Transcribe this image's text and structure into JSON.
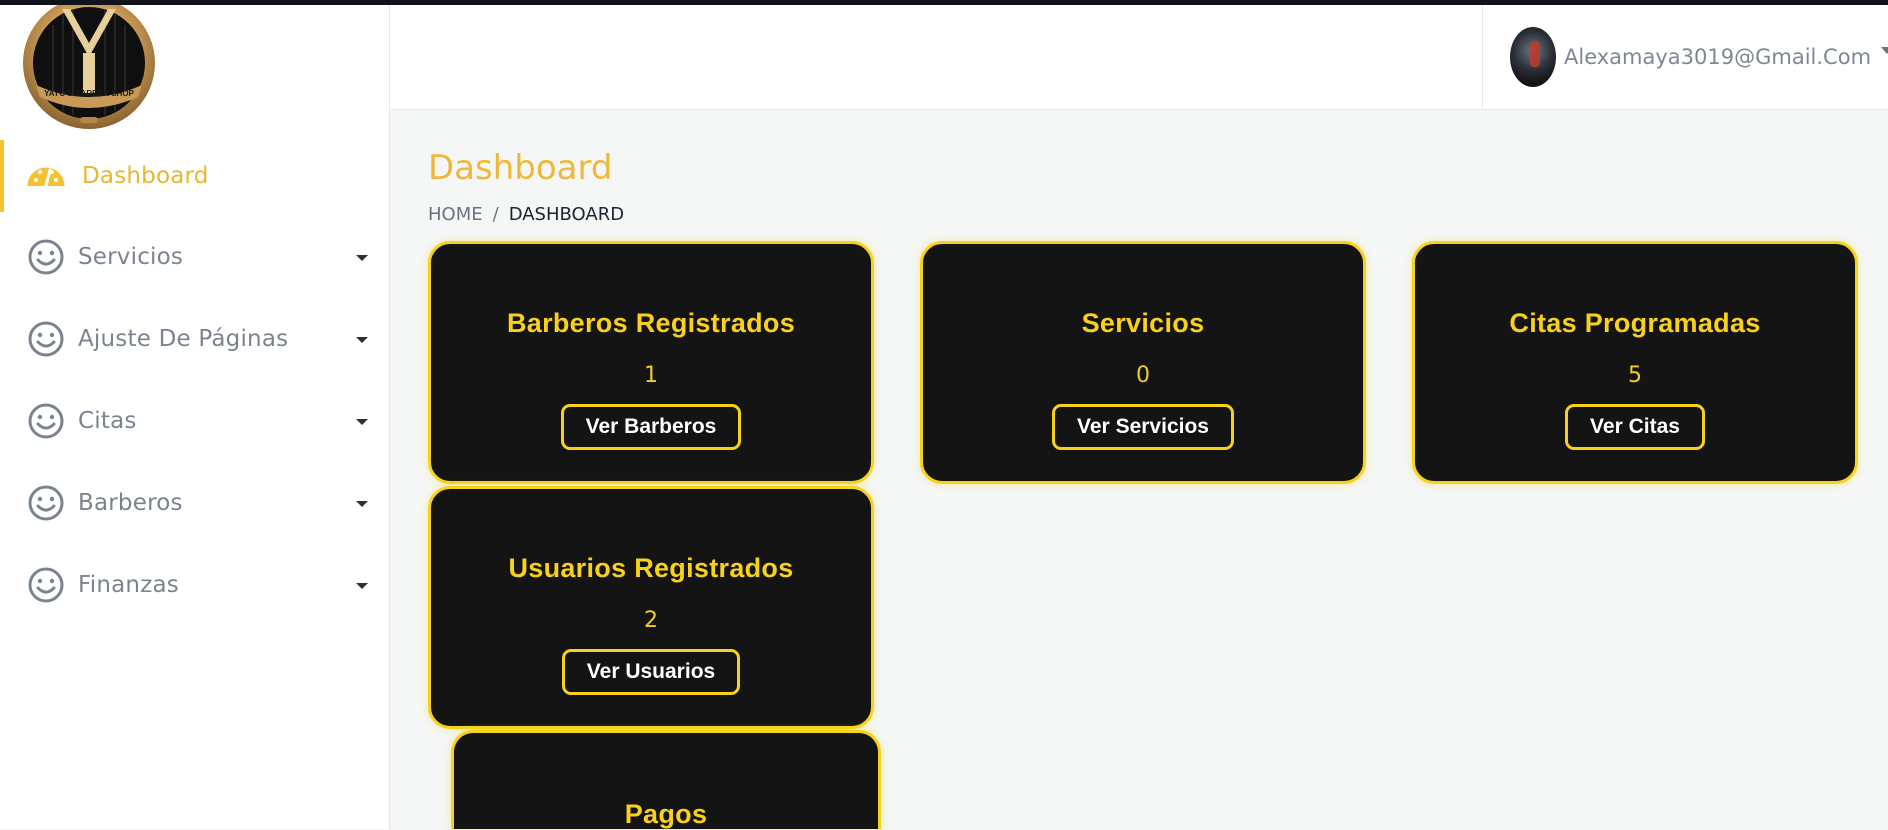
{
  "brand": {
    "logo_text": "YAYO'S BARBER SHOP"
  },
  "sidebar": {
    "items": [
      {
        "label": "Dashboard",
        "icon": "gauge-icon",
        "active": true
      },
      {
        "label": "Servicios",
        "icon": "smiley-icon"
      },
      {
        "label": "Ajuste De Páginas",
        "icon": "smiley-icon"
      },
      {
        "label": "Citas",
        "icon": "smiley-icon"
      },
      {
        "label": "Barberos",
        "icon": "smiley-icon"
      },
      {
        "label": "Finanzas",
        "icon": "smiley-icon"
      }
    ]
  },
  "header": {
    "user_email": "Alexamaya3019@Gmail.Com"
  },
  "page": {
    "title": "Dashboard",
    "breadcrumb": {
      "home": "HOME",
      "separator": "/",
      "current": "DASHBOARD"
    }
  },
  "cards": [
    {
      "title": "Barberos Registrados",
      "count": "1",
      "button": "Ver Barberos"
    },
    {
      "title": "Servicios",
      "count": "0",
      "button": "Ver Servicios"
    },
    {
      "title": "Citas Programadas",
      "count": "5",
      "button": "Ver Citas"
    },
    {
      "title": "Usuarios Registrados",
      "count": "2",
      "button": "Ver Usuarios"
    },
    {
      "title": "Pagos"
    }
  ],
  "colors": {
    "accent": "#f0b83a",
    "card_bg": "#141414",
    "card_border": "#f6d21c",
    "sidebar_text": "#7a8491"
  }
}
